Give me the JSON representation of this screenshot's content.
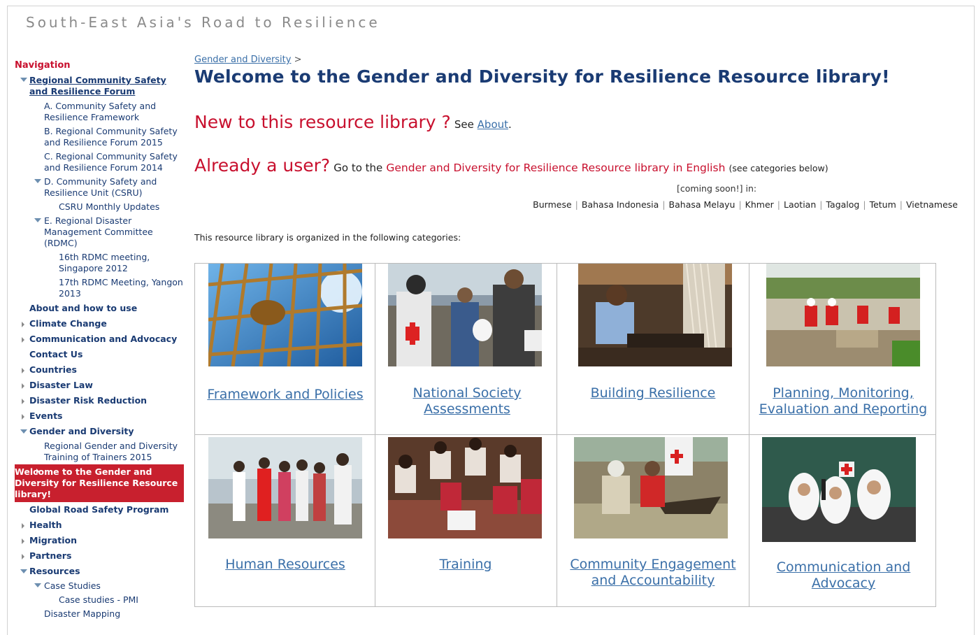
{
  "site": {
    "title": "South-East Asia's Road to Resilience"
  },
  "nav": {
    "heading": "Navigation",
    "items": [
      {
        "label": "Regional Community Safety and Resilience Forum"
      },
      {
        "label": "A. Community Safety and Resilience Framework"
      },
      {
        "label": "B. Regional Community Safety and Resilience Forum 2015"
      },
      {
        "label": "C. Regional Community Safety and Resilience Forum 2014"
      },
      {
        "label": "D. Community Safety and Resilience Unit (CSRU)"
      },
      {
        "label": "CSRU Monthly Updates"
      },
      {
        "label": "E. Regional Disaster Management Committee (RDMC)"
      },
      {
        "label": "16th RDMC meeting, Singapore 2012"
      },
      {
        "label": "17th RDMC Meeting, Yangon 2013"
      },
      {
        "label": "About and how to use"
      },
      {
        "label": "Climate Change"
      },
      {
        "label": "Communication and Advocacy"
      },
      {
        "label": "Contact Us"
      },
      {
        "label": "Countries"
      },
      {
        "label": "Disaster Law"
      },
      {
        "label": "Disaster Risk Reduction"
      },
      {
        "label": "Events"
      },
      {
        "label": "Gender and Diversity"
      },
      {
        "label": "Regional Gender and Diversity Training of Trainers 2015"
      },
      {
        "label": "Welcome to the Gender and Diversity for Resilience Resource library!"
      },
      {
        "label": "Global Road Safety Program"
      },
      {
        "label": "Health"
      },
      {
        "label": "Migration"
      },
      {
        "label": "Partners"
      },
      {
        "label": "Resources"
      },
      {
        "label": "Case Studies"
      },
      {
        "label": "Case studies - PMI"
      },
      {
        "label": "Disaster Mapping"
      }
    ]
  },
  "main": {
    "breadcrumb": {
      "link": "Gender and Diversity",
      "sep": ">"
    },
    "title": "Welcome to the Gender and Diversity for Resilience Resource library!",
    "new_user": {
      "prefix": "New to this resource library ?",
      "see": "See",
      "about": "About",
      "period": "."
    },
    "already_user": {
      "prefix": "Already a user?",
      "go": "Go to the",
      "library_link": "Gender and Diversity for Resilience Resource library in English",
      "note": "(see categories below)"
    },
    "coming_soon": "[coming soon!] in:",
    "languages": [
      "Burmese",
      "Bahasa Indonesia",
      "Bahasa Melayu",
      "Khmer",
      "Laotian",
      "Tagalog",
      "Tetum",
      "Vietnamese"
    ],
    "organized": "This resource library is organized in the following categories:"
  },
  "categories": [
    {
      "label": "Framework and Policies",
      "photo": "rope-net-photo"
    },
    {
      "label": "National Society Assessments",
      "photo": "relief-distribution-photo"
    },
    {
      "label": "Building Resilience",
      "photo": "weaving-woman-photo"
    },
    {
      "label": "Planning, Monitoring, Evaluation and Reporting",
      "photo": "volunteers-digging-photo"
    },
    {
      "label": "Human Resources",
      "photo": "people-queue-photo"
    },
    {
      "label": "Training",
      "photo": "training-circle-photo"
    },
    {
      "label": "Community Engagement and Accountability",
      "photo": "flood-boat-photo"
    },
    {
      "label": "Communication and Advocacy",
      "photo": "radio-studio-photo"
    }
  ],
  "colors": {
    "accent_red": "#c8102e",
    "nav_blue": "#1a3b73",
    "link_blue": "#3a6fa8",
    "active_bg": "#c8202e"
  }
}
